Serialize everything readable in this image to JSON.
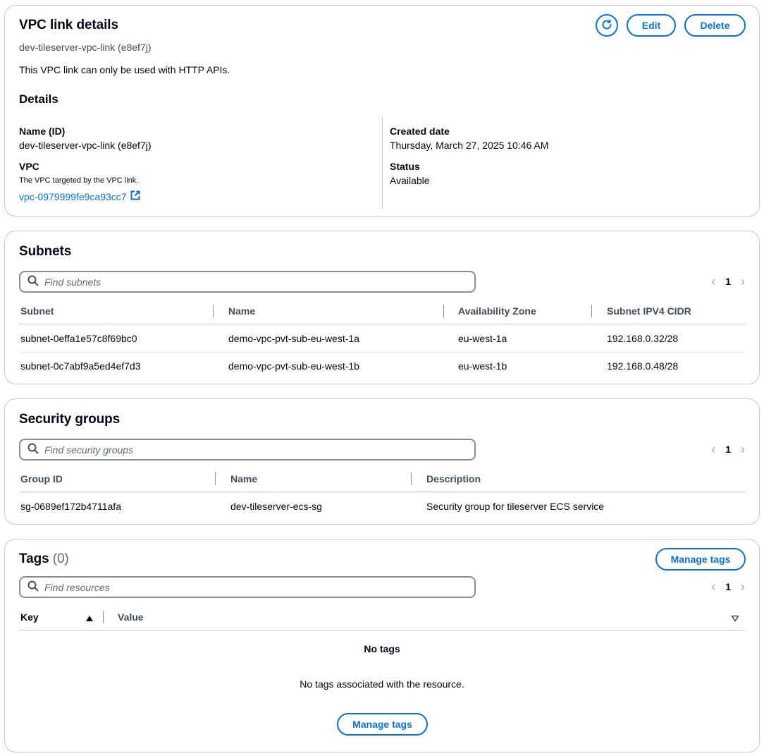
{
  "details_panel": {
    "title": "VPC link details",
    "subtitle": "dev-tileserver-vpc-link (e8ef7j)",
    "notice": "This VPC link can only be used with HTTP APIs.",
    "edit_label": "Edit",
    "delete_label": "Delete",
    "section_heading": "Details",
    "name_label": "Name (ID)",
    "name_value": "dev-tileserver-vpc-link (e8ef7j)",
    "vpc_label": "VPC",
    "vpc_description": "The VPC targeted by the VPC link.",
    "vpc_link_text": "vpc-0979999fe9ca93cc7",
    "created_label": "Created date",
    "created_value": "Thursday, March 27, 2025 10:46 AM",
    "status_label": "Status",
    "status_value": "Available"
  },
  "subnets_panel": {
    "title": "Subnets",
    "search_placeholder": "Find subnets",
    "page": "1",
    "columns": [
      "Subnet",
      "Name",
      "Availability Zone",
      "Subnet IPV4 CIDR"
    ],
    "rows": [
      [
        "subnet-0effa1e57c8f69bc0",
        "demo-vpc-pvt-sub-eu-west-1a",
        "eu-west-1a",
        "192.168.0.32/28"
      ],
      [
        "subnet-0c7abf9a5ed4ef7d3",
        "demo-vpc-pvt-sub-eu-west-1b",
        "eu-west-1b",
        "192.168.0.48/28"
      ]
    ]
  },
  "security_groups_panel": {
    "title": "Security groups",
    "search_placeholder": "Find security groups",
    "page": "1",
    "columns": [
      "Group ID",
      "Name",
      "Description"
    ],
    "rows": [
      [
        "sg-0689ef172b4711afa",
        "dev-tileserver-ecs-sg",
        "Security group for tileserver ECS service"
      ]
    ]
  },
  "tags_panel": {
    "title": "Tags",
    "count": "(0)",
    "manage_tags_label": "Manage tags",
    "search_placeholder": "Find resources",
    "page": "1",
    "columns": [
      "Key",
      "Value"
    ],
    "empty_title": "No tags",
    "empty_message": "No tags associated with the resource.",
    "empty_button_label": "Manage tags"
  },
  "colors": {
    "accent": "#0972d3",
    "border": "#c6c6cd",
    "text": "#000716",
    "muted": "#414d5c"
  },
  "icons": {
    "refresh": "refresh-icon",
    "external_link": "external-link-icon",
    "search": "search-icon",
    "chevron_left": "chevron-left-icon",
    "chevron_right": "chevron-right-icon",
    "sort_ascending": "sort-ascending-icon",
    "column_settings": "caret-down-icon"
  }
}
